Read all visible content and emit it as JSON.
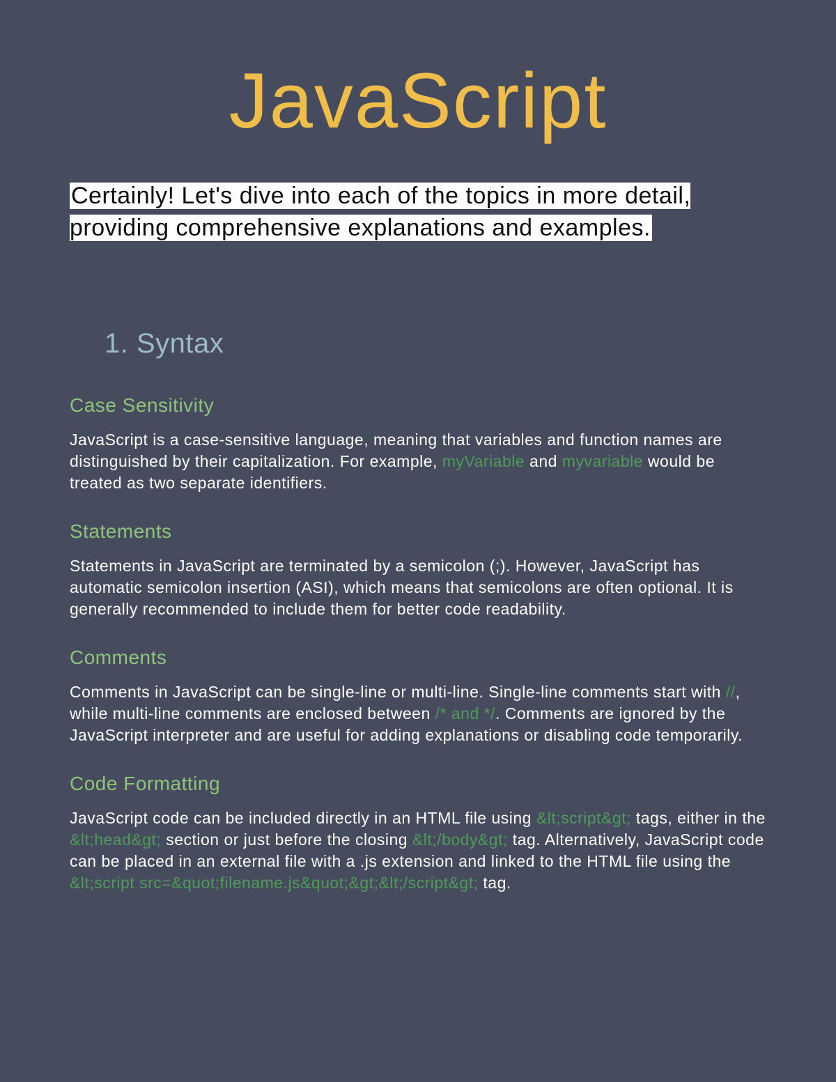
{
  "title": "JavaScript",
  "intro": "Certainly! Let's dive into each of the topics in more detail, providing comprehensive explanations and examples.",
  "section": {
    "heading": "1. Syntax",
    "sub1": {
      "heading": "Case Sensitivity",
      "t1": "JavaScript is a case-sensitive language, meaning that variables and function names are distinguished by their capitalization. For example, ",
      "c1": "myVariable",
      "t2": " and ",
      "c2": "myvariable",
      "t3": " would be treated as two separate identifiers."
    },
    "sub2": {
      "heading": "Statements",
      "t1": "Statements in JavaScript are terminated by a semicolon (;). However, JavaScript has automatic semicolon insertion (ASI), which means that semicolons are often optional. It is generally recommended to include them for better code readability."
    },
    "sub3": {
      "heading": "Comments",
      "t1": "Comments in JavaScript can be single-line or multi-line. Single-line comments start with ",
      "c1": "//",
      "t2": ", while multi-line comments are enclosed between ",
      "c2": "/* and */",
      "t3": ". Comments are ignored by the JavaScript interpreter and are useful for adding explanations or disabling code temporarily."
    },
    "sub4": {
      "heading": "Code Formatting",
      "t1": "JavaScript code can be included directly in an HTML file using ",
      "c1": "&lt;script&gt;",
      "t2": " tags, either in the ",
      "c2": "&lt;head&gt;",
      "t3": " section or just before the closing ",
      "c3": "&lt;/body&gt;",
      "t4": " tag. Alternatively, JavaScript code can be placed in an external file with a .js extension and linked to the HTML file using the ",
      "c4": "&lt;script src=&quot;filename.js&quot;&gt;&lt;/script&gt;",
      "t5": " tag."
    }
  }
}
